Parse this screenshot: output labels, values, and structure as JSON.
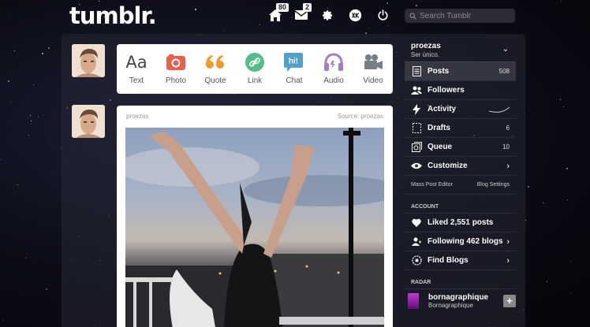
{
  "header": {
    "logo": "tumblr.",
    "badges": {
      "home": "80",
      "inbox": "2"
    },
    "search_placeholder": "Search Tumblr"
  },
  "postbar": [
    {
      "label": "Text",
      "icon": "text-icon",
      "glyph": "Aa",
      "color": "#444444"
    },
    {
      "label": "Photo",
      "icon": "camera-icon",
      "color": "#e8604c"
    },
    {
      "label": "Quote",
      "icon": "quote-icon",
      "glyph": "“",
      "color": "#f2992e"
    },
    {
      "label": "Link",
      "icon": "link-icon",
      "color": "#56bc8a"
    },
    {
      "label": "Chat",
      "icon": "chat-icon",
      "glyph": "hi!",
      "color": "#529ecc"
    },
    {
      "label": "Audio",
      "icon": "headphones-icon",
      "color": "#a77dc2"
    },
    {
      "label": "Video",
      "icon": "video-camera-icon",
      "color": "#748089"
    }
  ],
  "post": {
    "author": "proezas",
    "source": "Source: proezas"
  },
  "sidebar": {
    "blog_name": "proezas",
    "blog_subtitle": "Ser único.",
    "rows": [
      {
        "label": "Posts",
        "value": "508",
        "icon": "posts-icon"
      },
      {
        "label": "Followers",
        "value": "",
        "icon": "followers-icon"
      },
      {
        "label": "Activity",
        "value": "",
        "icon": "activity-icon"
      },
      {
        "label": "Drafts",
        "value": "6",
        "icon": "drafts-icon"
      },
      {
        "label": "Queue",
        "value": "10",
        "icon": "queue-icon"
      },
      {
        "label": "Customize",
        "value": "",
        "icon": "eye-icon"
      }
    ],
    "mass_post_editor": "Mass Post Editor",
    "blog_settings": "Blog Settings",
    "account_heading": "ACCOUNT",
    "account_rows": [
      {
        "label": "Liked 2,551 posts",
        "icon": "heart-icon"
      },
      {
        "label": "Following 462 blogs",
        "icon": "following-icon"
      },
      {
        "label": "Find Blogs",
        "icon": "compass-icon"
      }
    ],
    "radar_heading": "RADAR",
    "radar": {
      "name": "bornagraphique",
      "subtitle": "Bornagraphique"
    }
  },
  "colors": {
    "accent": "#529ecc",
    "panel": "#262837"
  }
}
